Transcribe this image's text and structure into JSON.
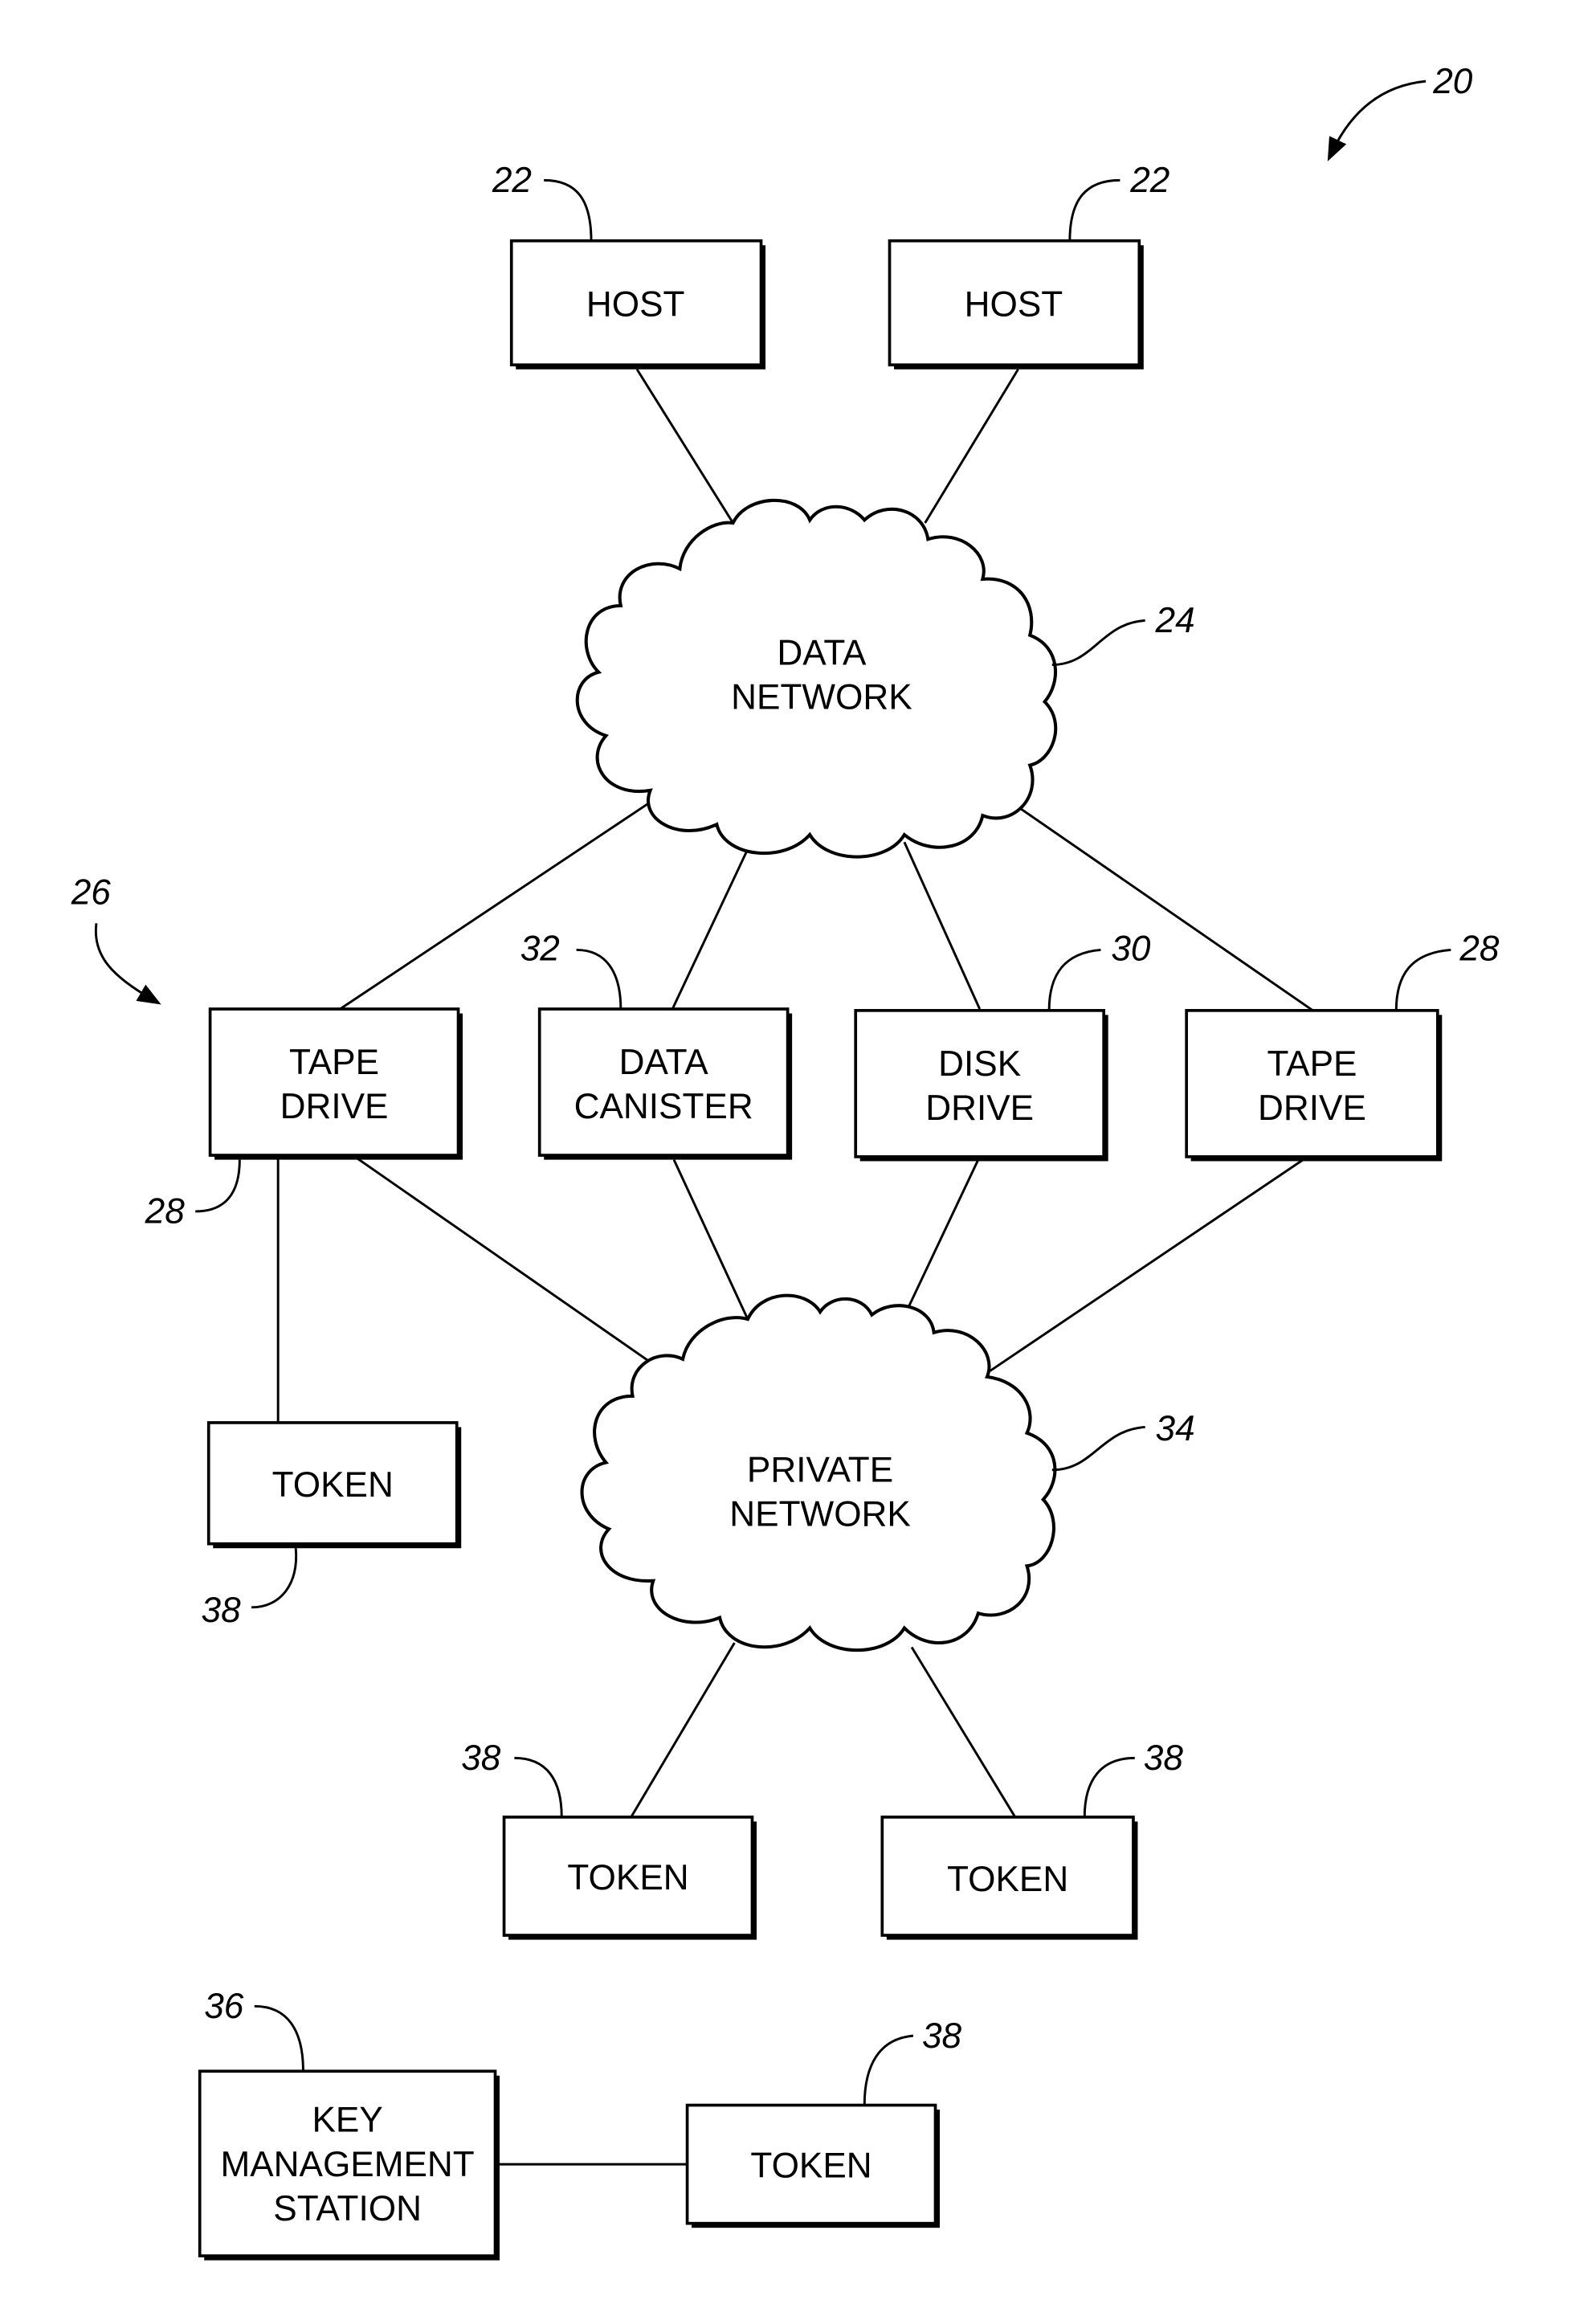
{
  "figure": {
    "reference": "20",
    "nodes": {
      "host_left": {
        "lines": [
          "HOST"
        ],
        "ref": "22"
      },
      "host_right": {
        "lines": [
          "HOST"
        ],
        "ref": "22"
      },
      "data_network": {
        "lines": [
          "DATA",
          "NETWORK"
        ],
        "ref": "24"
      },
      "group_ref": "26",
      "tape_drive_left": {
        "lines": [
          "TAPE",
          "DRIVE"
        ],
        "ref": "28"
      },
      "data_canister": {
        "lines": [
          "DATA",
          "CANISTER"
        ],
        "ref": "32"
      },
      "disk_drive": {
        "lines": [
          "DISK",
          "DRIVE"
        ],
        "ref": "30"
      },
      "tape_drive_right": {
        "lines": [
          "TAPE",
          "DRIVE"
        ],
        "ref": "28"
      },
      "token_left": {
        "lines": [
          "TOKEN"
        ],
        "ref": "38"
      },
      "private_network": {
        "lines": [
          "PRIVATE",
          "NETWORK"
        ],
        "ref": "34"
      },
      "token_mid_left": {
        "lines": [
          "TOKEN"
        ],
        "ref": "38"
      },
      "token_mid_right": {
        "lines": [
          "TOKEN"
        ],
        "ref": "38"
      },
      "key_management_station": {
        "lines": [
          "KEY",
          "MANAGEMENT",
          "STATION"
        ],
        "ref": "36"
      },
      "token_kms": {
        "lines": [
          "TOKEN"
        ],
        "ref": "38"
      }
    }
  }
}
